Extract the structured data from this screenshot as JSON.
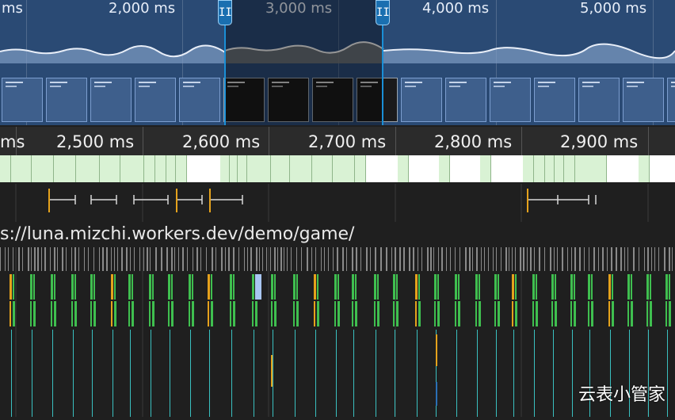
{
  "overview": {
    "ruler_labels": [
      "ms",
      "2,000 ms",
      "3,000 ms",
      "4,000 ms",
      "5,000 ms"
    ],
    "handle_glyph": "II"
  },
  "detail_ruler": {
    "labels": [
      "ms",
      "2,500 ms",
      "2,600 ms",
      "2,700 ms",
      "2,800 ms",
      "2,900 ms"
    ]
  },
  "main_track": {
    "url": "s://luna.mizchi.workers.dev/demo/game/"
  },
  "watermark": "云表小管家",
  "colors": {
    "overview_bg": "#2a4a74",
    "selection_handle": "#1a8fd6",
    "frame_green": "#d9f2d4",
    "task_gray": "#8a8a8a",
    "script_green": "#3fbf4f",
    "script_yellow": "#e5a21c",
    "selected_task": "#a9c6f2",
    "paint_teal": "#3ac0c0"
  }
}
